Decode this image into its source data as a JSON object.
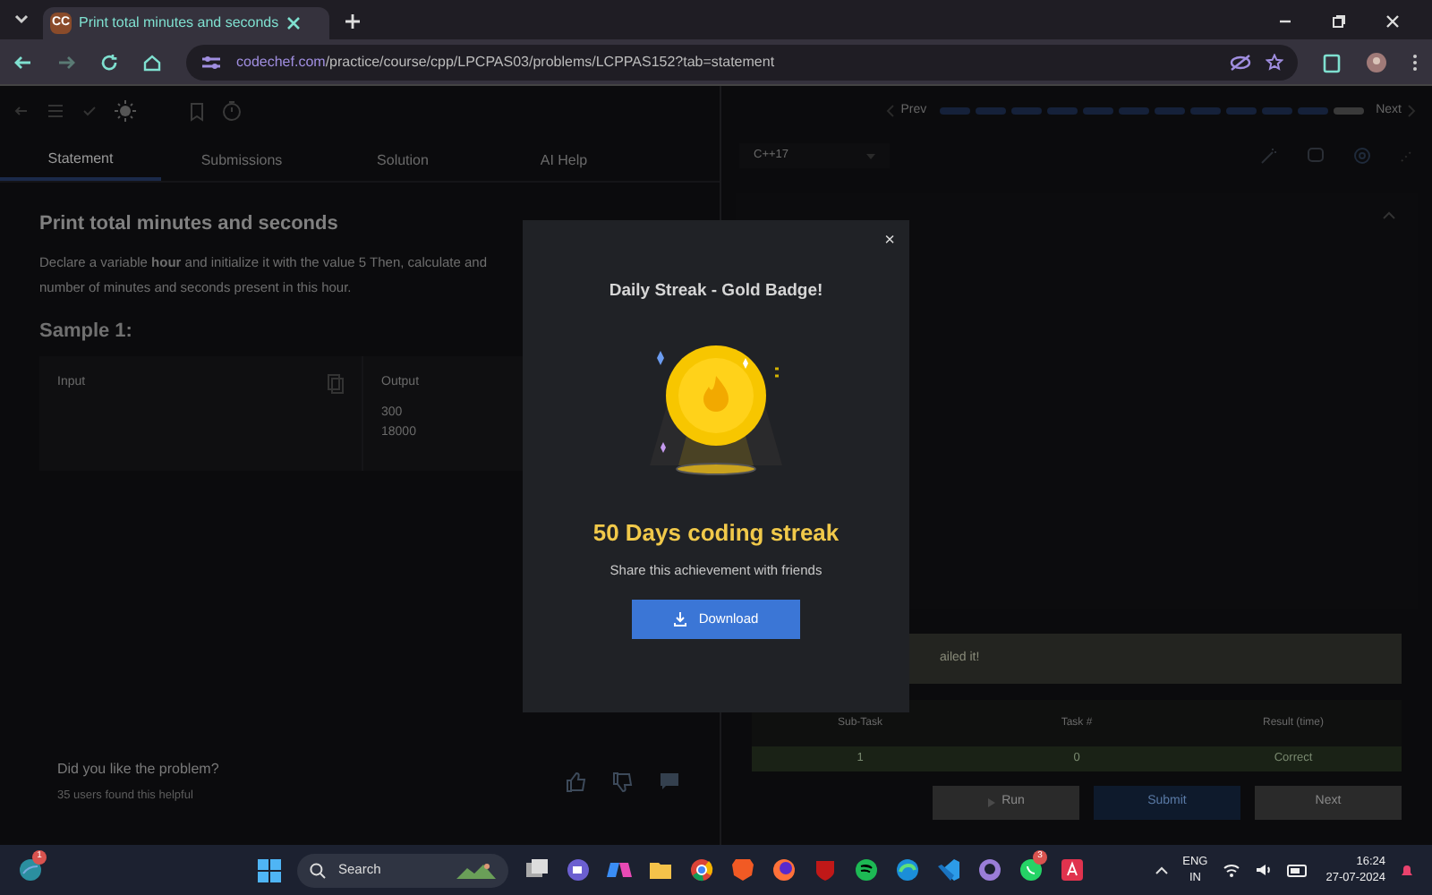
{
  "browser": {
    "tab_title": "Print total minutes and seconds",
    "favicon": "CC",
    "url_host": "codechef.com",
    "url_path": "/practice/course/cpp/LPCPAS03/problems/LCPPAS152?tab=statement"
  },
  "toolbar": {
    "prev": "Prev",
    "next": "Next",
    "steps": [
      {
        "done": true
      },
      {
        "done": true
      },
      {
        "done": true
      },
      {
        "done": true
      },
      {
        "done": true
      },
      {
        "done": true
      },
      {
        "done": true
      },
      {
        "done": true
      },
      {
        "done": true
      },
      {
        "done": true
      },
      {
        "done": true
      },
      {
        "done": false
      }
    ]
  },
  "tabs": [
    {
      "label": "Statement",
      "selected": true
    },
    {
      "label": "Submissions",
      "selected": false
    },
    {
      "label": "Solution",
      "selected": false
    },
    {
      "label": "AI Help",
      "selected": false
    }
  ],
  "problem": {
    "title": "Print total minutes and seconds",
    "description": "Declare a variable **hour** and initialize it with the value 5 Then, calculate and",
    "description_2": "number of minutes and seconds present in this hour.",
    "sample_title": "Sample 1:",
    "input_label": "Input",
    "output_label": "Output",
    "output_lines": [
      "300",
      "18000"
    ]
  },
  "feedback": {
    "question": "Did you like the problem?",
    "helpful": "35 users found this helpful"
  },
  "editor": {
    "language": "C++17",
    "banner": "ailed it!",
    "columns": [
      "Sub-Task",
      "Task #",
      "Result (time)"
    ],
    "row": [
      "1",
      "0",
      "Correct"
    ],
    "buttons": [
      {
        "label": "Run",
        "kind": "run"
      },
      {
        "label": "Submit",
        "kind": "submit"
      },
      {
        "label": "Next",
        "kind": "next"
      }
    ]
  },
  "modal": {
    "close": "×",
    "title": "Daily Streak - Gold Badge!",
    "headline": "50 Days coding streak",
    "subtitle": "Share this achievement with friends",
    "button": "Download"
  },
  "taskbar": {
    "weather_badge": "1",
    "search_placeholder": "Search",
    "whatsapp_badge": "3",
    "language": "ENG",
    "region": "IN",
    "time": "16:24",
    "date": "27-07-2024"
  }
}
